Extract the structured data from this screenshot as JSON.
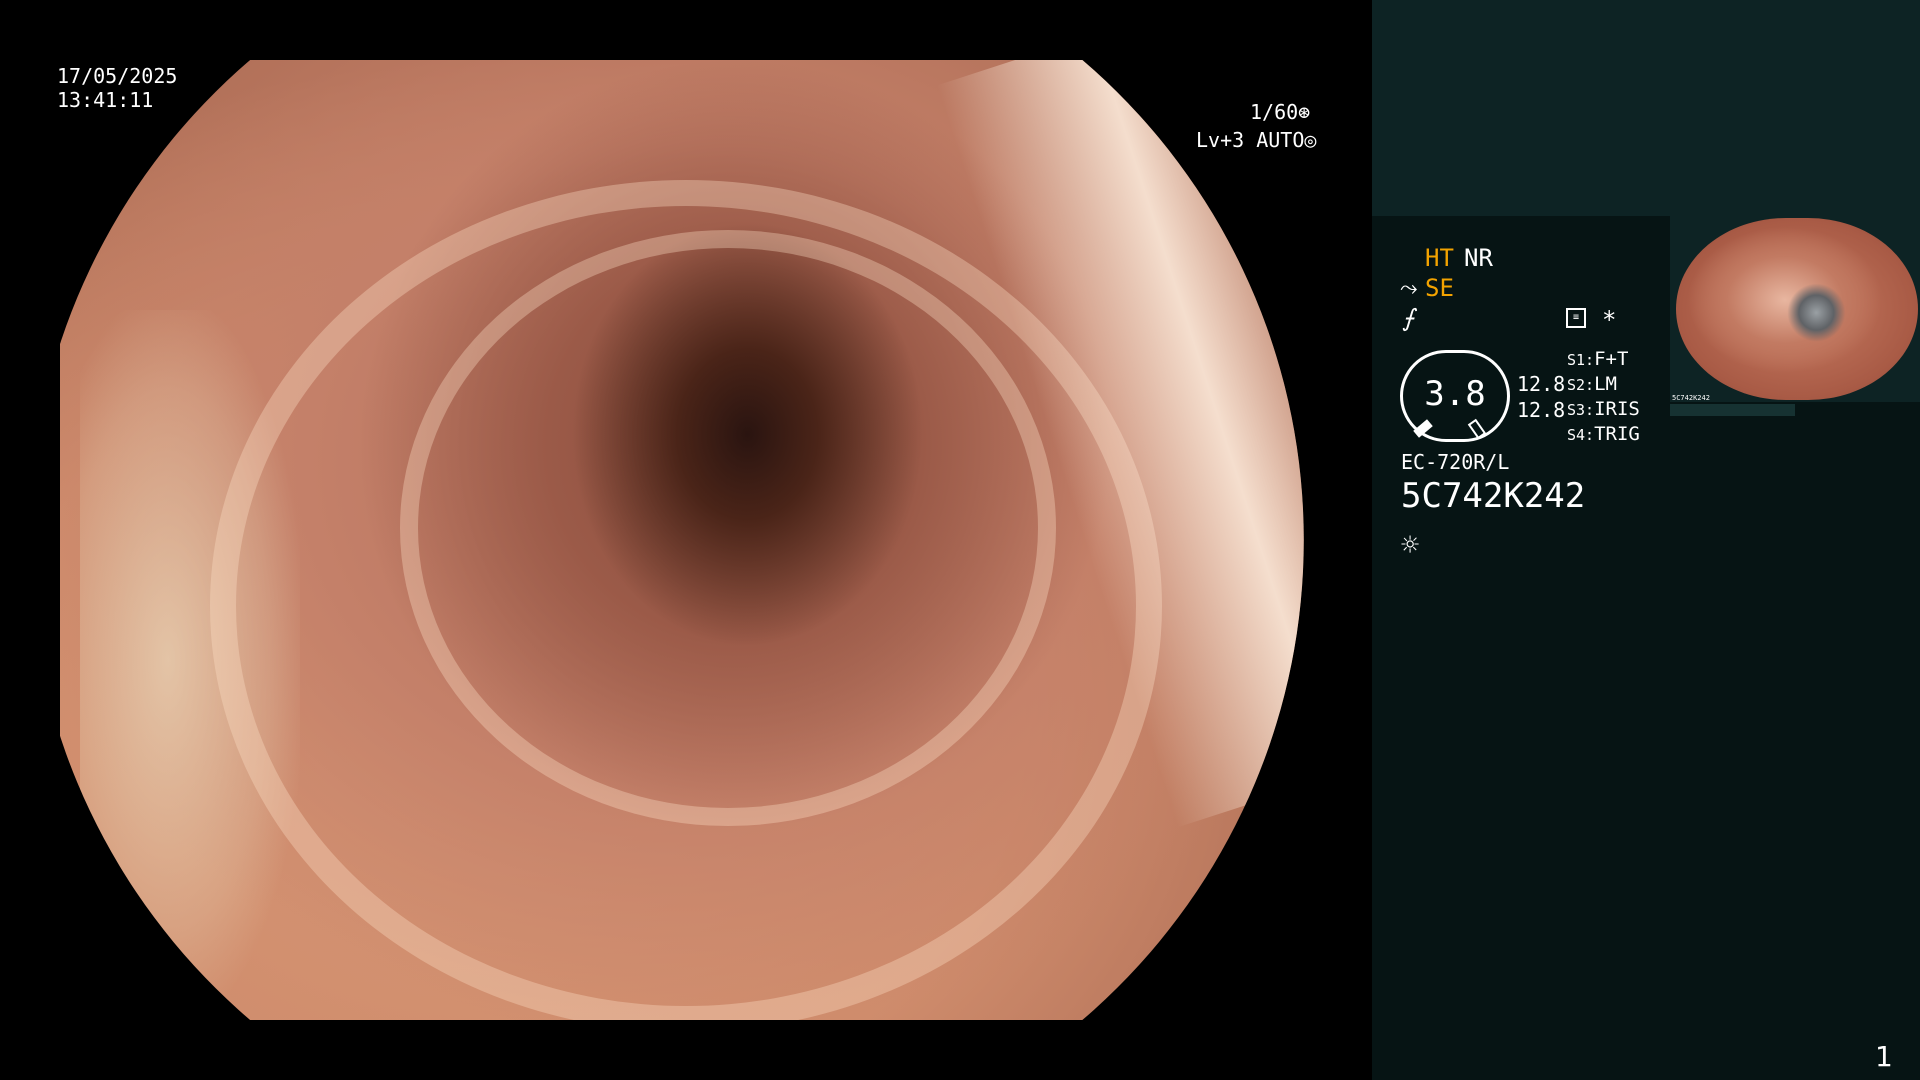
{
  "video_overlay": {
    "date": "17/05/2025",
    "time": "13:41:11",
    "shutter": "1/60⊛",
    "level": "Lv+3 AUTO◎"
  },
  "status": {
    "ht": "HT",
    "nr": "NR",
    "se_icon": "⤳",
    "se": "SE",
    "f_icon": "⨍",
    "grid_icon": "≡",
    "asterisk": "*"
  },
  "gauge": {
    "value": "3.8",
    "num_a": "12.8",
    "num_b": "12.8"
  },
  "switches": [
    {
      "key": "S1:",
      "val": "F+T"
    },
    {
      "key": "S2:",
      "val": "LM"
    },
    {
      "key": "S3:",
      "val": "IRIS"
    },
    {
      "key": "S4:",
      "val": "TRIG"
    }
  ],
  "scope": {
    "model": "EC-720R/L",
    "serial": "5C742K242",
    "light_icon": "☼"
  },
  "thumbnail": {
    "caption": "5C742K242"
  },
  "page_number": "1",
  "colors": {
    "accent_orange": "#f3a300",
    "panel_top": "#0d2324",
    "panel_body": "#061414"
  }
}
